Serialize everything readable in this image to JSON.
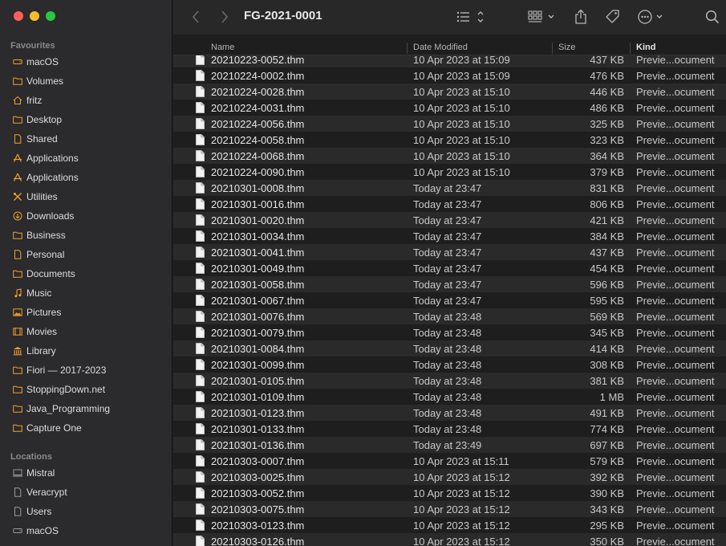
{
  "toolbar": {
    "title": "FG-2021-0001",
    "icons": [
      "chevron-left-icon",
      "chevron-right-icon",
      "list-view-icon",
      "group-grid-icon",
      "share-icon",
      "tag-icon",
      "more-icon",
      "search-icon"
    ]
  },
  "sidebar": {
    "favourites_title": "Favourites",
    "favourites": [
      {
        "label": "macOS",
        "icon": "drive-icon"
      },
      {
        "label": "Volumes",
        "icon": "folder-icon"
      },
      {
        "label": "fritz",
        "icon": "home-icon"
      },
      {
        "label": "Desktop",
        "icon": "folder-icon"
      },
      {
        "label": "Shared",
        "icon": "document-icon"
      },
      {
        "label": "Applications",
        "icon": "applications-icon"
      },
      {
        "label": "Applications",
        "icon": "applications-icon"
      },
      {
        "label": "Utilities",
        "icon": "utilities-icon"
      },
      {
        "label": "Downloads",
        "icon": "downloads-icon"
      },
      {
        "label": "Business",
        "icon": "folder-icon"
      },
      {
        "label": "Personal",
        "icon": "document-icon"
      },
      {
        "label": "Documents",
        "icon": "folder-icon"
      },
      {
        "label": "Music",
        "icon": "music-icon"
      },
      {
        "label": "Pictures",
        "icon": "pictures-icon"
      },
      {
        "label": "Movies",
        "icon": "movies-icon"
      },
      {
        "label": "Library",
        "icon": "library-icon"
      },
      {
        "label": "Fiori — 2017-2023",
        "icon": "folder-icon"
      },
      {
        "label": "StoppingDown.net",
        "icon": "folder-icon"
      },
      {
        "label": "Java_Programming",
        "icon": "folder-icon"
      },
      {
        "label": "Capture One",
        "icon": "folder-icon"
      }
    ],
    "locations_title": "Locations",
    "locations": [
      {
        "label": "Mistral",
        "icon": "computer-icon"
      },
      {
        "label": "Veracrypt",
        "icon": "document-icon"
      },
      {
        "label": "Users",
        "icon": "document-icon"
      },
      {
        "label": "macOS",
        "icon": "drive-icon"
      }
    ]
  },
  "columns": {
    "name": "Name",
    "date": "Date Modified",
    "size": "Size",
    "kind": "Kind"
  },
  "files": [
    {
      "name": "20210223-0052.thm",
      "date": "10 Apr 2023 at 15:09",
      "size": "437 KB",
      "kind": "Previe...ocument"
    },
    {
      "name": "20210224-0002.thm",
      "date": "10 Apr 2023 at 15:09",
      "size": "476 KB",
      "kind": "Previe...ocument"
    },
    {
      "name": "20210224-0028.thm",
      "date": "10 Apr 2023 at 15:10",
      "size": "446 KB",
      "kind": "Previe...ocument"
    },
    {
      "name": "20210224-0031.thm",
      "date": "10 Apr 2023 at 15:10",
      "size": "486 KB",
      "kind": "Previe...ocument"
    },
    {
      "name": "20210224-0056.thm",
      "date": "10 Apr 2023 at 15:10",
      "size": "325 KB",
      "kind": "Previe...ocument"
    },
    {
      "name": "20210224-0058.thm",
      "date": "10 Apr 2023 at 15:10",
      "size": "323 KB",
      "kind": "Previe...ocument"
    },
    {
      "name": "20210224-0068.thm",
      "date": "10 Apr 2023 at 15:10",
      "size": "364 KB",
      "kind": "Previe...ocument"
    },
    {
      "name": "20210224-0090.thm",
      "date": "10 Apr 2023 at 15:10",
      "size": "379 KB",
      "kind": "Previe...ocument"
    },
    {
      "name": "20210301-0008.thm",
      "date": "Today at 23:47",
      "size": "831 KB",
      "kind": "Previe...ocument"
    },
    {
      "name": "20210301-0016.thm",
      "date": "Today at 23:47",
      "size": "806 KB",
      "kind": "Previe...ocument"
    },
    {
      "name": "20210301-0020.thm",
      "date": "Today at 23:47",
      "size": "421 KB",
      "kind": "Previe...ocument"
    },
    {
      "name": "20210301-0034.thm",
      "date": "Today at 23:47",
      "size": "384 KB",
      "kind": "Previe...ocument"
    },
    {
      "name": "20210301-0041.thm",
      "date": "Today at 23:47",
      "size": "437 KB",
      "kind": "Previe...ocument"
    },
    {
      "name": "20210301-0049.thm",
      "date": "Today at 23:47",
      "size": "454 KB",
      "kind": "Previe...ocument"
    },
    {
      "name": "20210301-0058.thm",
      "date": "Today at 23:47",
      "size": "596 KB",
      "kind": "Previe...ocument"
    },
    {
      "name": "20210301-0067.thm",
      "date": "Today at 23:47",
      "size": "595 KB",
      "kind": "Previe...ocument"
    },
    {
      "name": "20210301-0076.thm",
      "date": "Today at 23:48",
      "size": "569 KB",
      "kind": "Previe...ocument"
    },
    {
      "name": "20210301-0079.thm",
      "date": "Today at 23:48",
      "size": "345 KB",
      "kind": "Previe...ocument"
    },
    {
      "name": "20210301-0084.thm",
      "date": "Today at 23:48",
      "size": "414 KB",
      "kind": "Previe...ocument"
    },
    {
      "name": "20210301-0099.thm",
      "date": "Today at 23:48",
      "size": "308 KB",
      "kind": "Previe...ocument"
    },
    {
      "name": "20210301-0105.thm",
      "date": "Today at 23:48",
      "size": "381 KB",
      "kind": "Previe...ocument"
    },
    {
      "name": "20210301-0109.thm",
      "date": "Today at 23:48",
      "size": "1 MB",
      "kind": "Previe...ocument"
    },
    {
      "name": "20210301-0123.thm",
      "date": "Today at 23:48",
      "size": "491 KB",
      "kind": "Previe...ocument"
    },
    {
      "name": "20210301-0133.thm",
      "date": "Today at 23:48",
      "size": "774 KB",
      "kind": "Previe...ocument"
    },
    {
      "name": "20210301-0136.thm",
      "date": "Today at 23:49",
      "size": "697 KB",
      "kind": "Previe...ocument"
    },
    {
      "name": "20210303-0007.thm",
      "date": "10 Apr 2023 at 15:11",
      "size": "579 KB",
      "kind": "Previe...ocument"
    },
    {
      "name": "20210303-0025.thm",
      "date": "10 Apr 2023 at 15:12",
      "size": "392 KB",
      "kind": "Previe...ocument"
    },
    {
      "name": "20210303-0052.thm",
      "date": "10 Apr 2023 at 15:12",
      "size": "390 KB",
      "kind": "Previe...ocument"
    },
    {
      "name": "20210303-0075.thm",
      "date": "10 Apr 2023 at 15:12",
      "size": "343 KB",
      "kind": "Previe...ocument"
    },
    {
      "name": "20210303-0123.thm",
      "date": "10 Apr 2023 at 15:12",
      "size": "295 KB",
      "kind": "Previe...ocument"
    },
    {
      "name": "20210303-0126.thm",
      "date": "10 Apr 2023 at 15:12",
      "size": "350 KB",
      "kind": "Previe...ocument"
    }
  ],
  "colors": {
    "accent": "#f0a030",
    "window_bg": "#1e1e1e",
    "sidebar_bg": "#2b2a2c",
    "row_alt": "#2a2a2a"
  }
}
